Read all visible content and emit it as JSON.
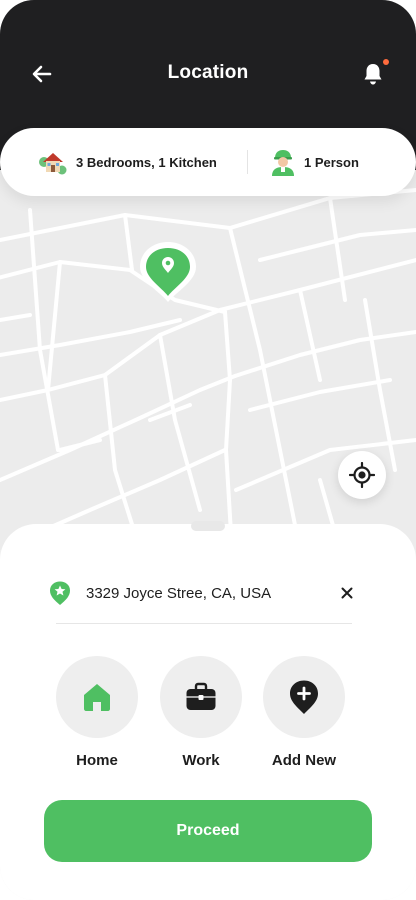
{
  "header": {
    "title": "Location",
    "back_icon": "arrow-left-icon",
    "bell_icon": "bell-icon",
    "has_notification": true
  },
  "booking_summary": {
    "rooms_label": "3 Bedrooms, 1 Kitchen",
    "rooms_icon": "house-icon",
    "persons_label": "1 Person",
    "persons_icon": "cleaner-person-icon"
  },
  "map": {
    "pin_icon": "location-pin-icon",
    "locate_icon": "crosshair-icon"
  },
  "address": {
    "value": "3329  Joyce Stree, CA, USA",
    "icon": "star-shield-icon",
    "clear_icon": "close-icon"
  },
  "saved_places": [
    {
      "label": "Home",
      "icon": "home-icon"
    },
    {
      "label": "Work",
      "icon": "briefcase-icon"
    },
    {
      "label": "Add New",
      "icon": "add-pin-icon"
    }
  ],
  "proceed_label": "Proceed",
  "colors": {
    "primary": "#4fbf62",
    "dark": "#1f1f21",
    "notification": "#ff6b3d"
  }
}
